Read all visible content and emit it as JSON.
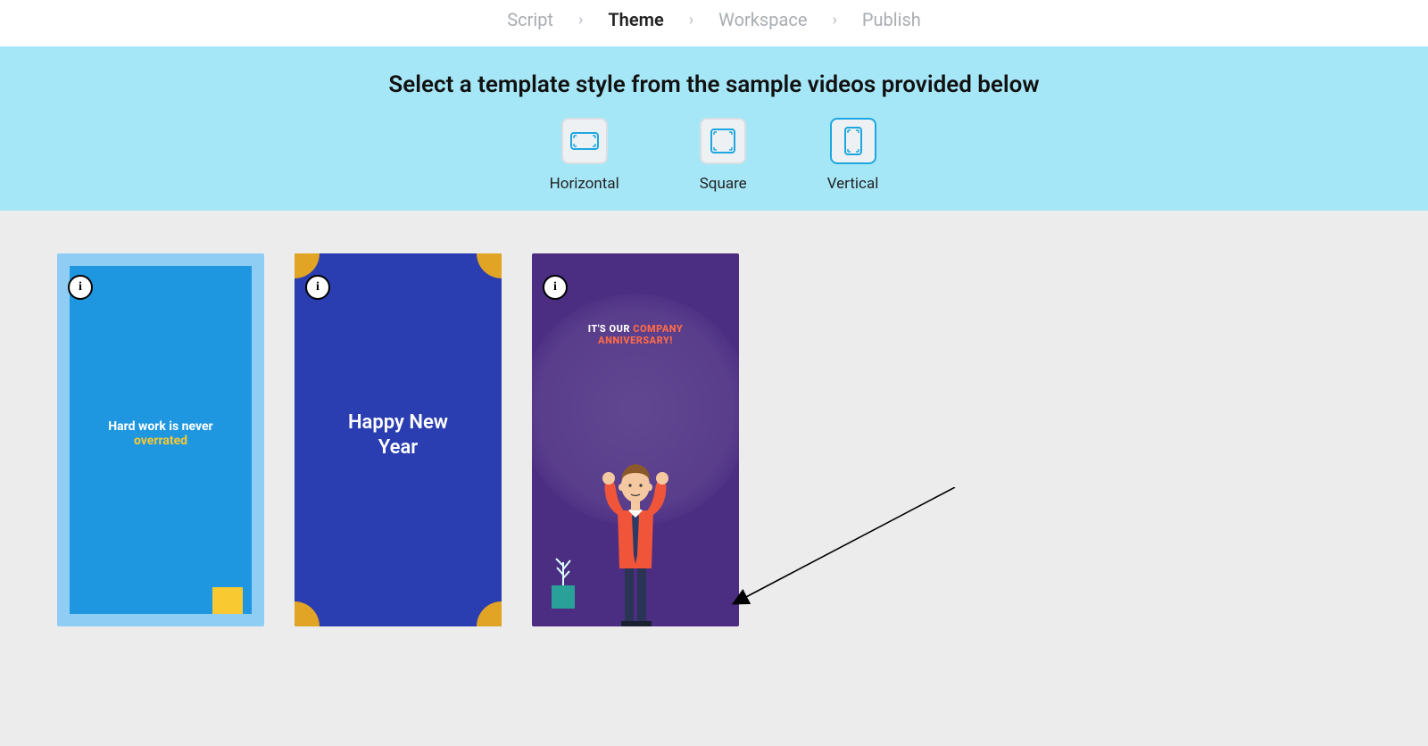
{
  "breadcrumb": {
    "steps": [
      "Script",
      "Theme",
      "Workspace",
      "Publish"
    ],
    "active_index": 1
  },
  "banner": {
    "heading": "Select a template style from the sample videos provided below",
    "aspects": [
      {
        "label": "Horizontal",
        "selected": false
      },
      {
        "label": "Square",
        "selected": false
      },
      {
        "label": "Vertical",
        "selected": true
      }
    ]
  },
  "templates": [
    {
      "line1": "Hard work is never",
      "line2": "overrated"
    },
    {
      "line1": "Happy New",
      "line2": "Year"
    },
    {
      "line1_white": "IT'S OUR ",
      "line1_orange": "COMPANY",
      "line2_orange": "ANNIVERSARY!"
    }
  ],
  "info_glyph": "i"
}
